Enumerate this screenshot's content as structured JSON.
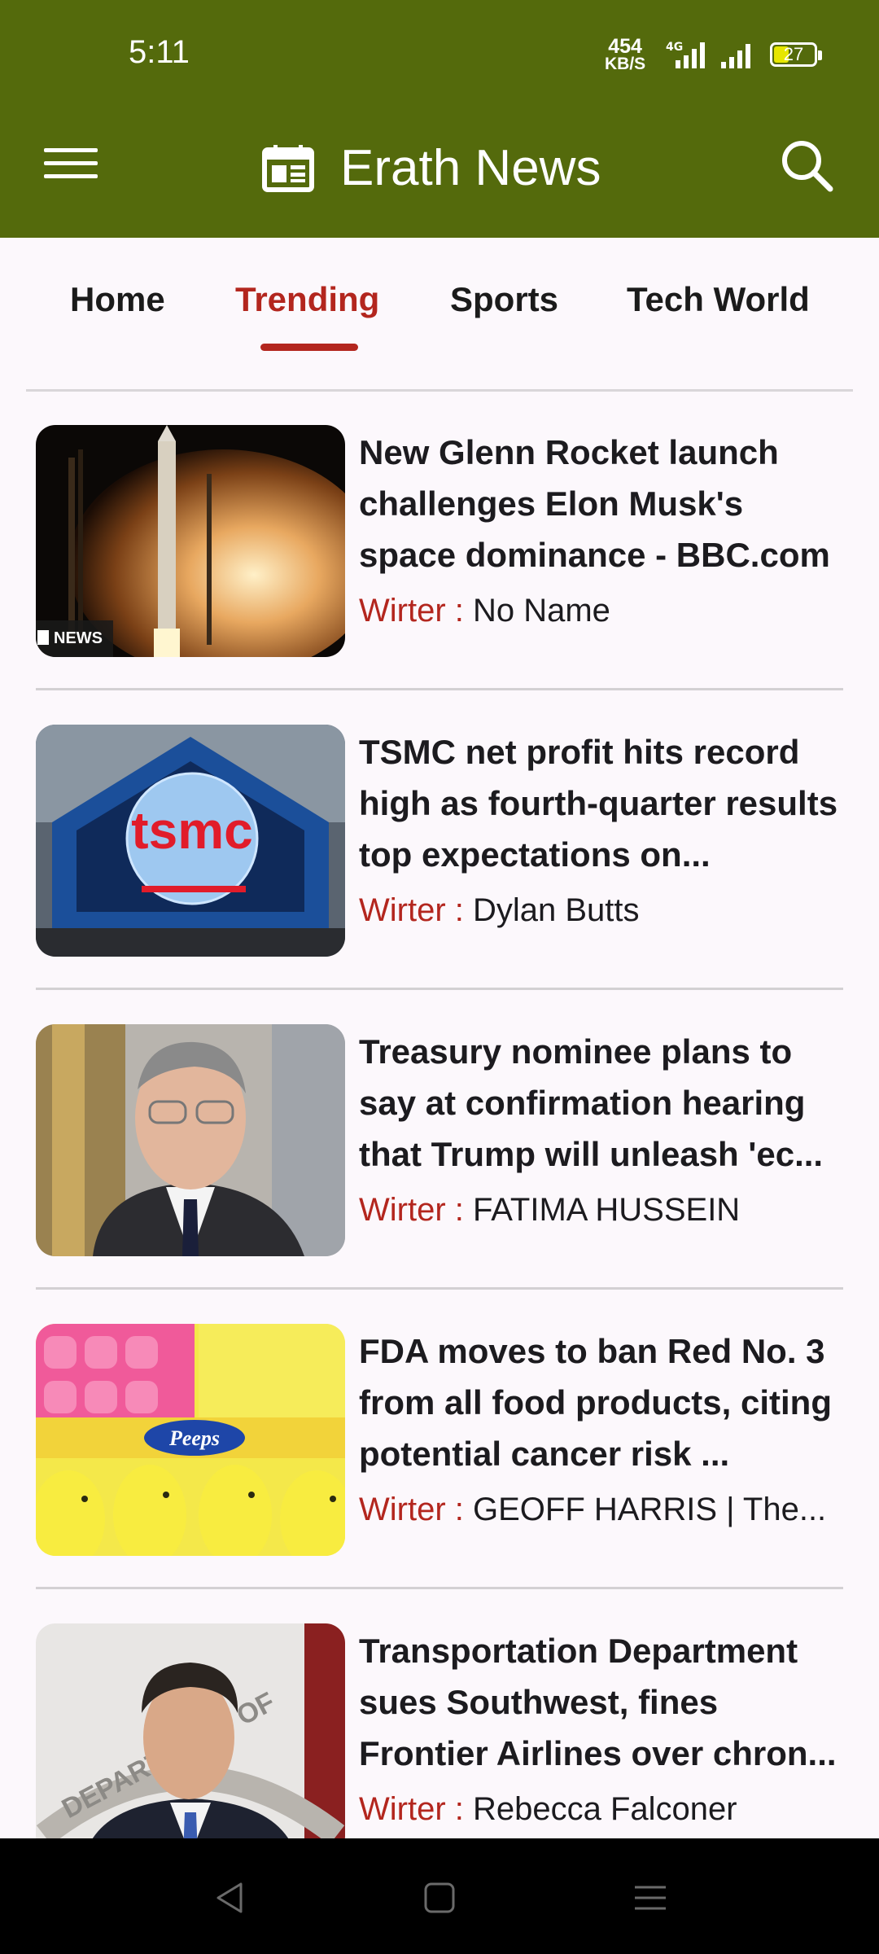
{
  "status_bar": {
    "time": "5:11",
    "net_speed_value": "454",
    "net_speed_unit": "KB/S",
    "network_type": "4G",
    "battery_level": "27"
  },
  "app_bar": {
    "title": "Erath News",
    "menu_icon": "hamburger-menu-icon",
    "logo_icon": "newspaper-icon",
    "search_icon": "search-icon"
  },
  "tabs": [
    {
      "label": "Home",
      "active": false
    },
    {
      "label": "Trending",
      "active": true
    },
    {
      "label": "Sports",
      "active": false
    },
    {
      "label": "Tech World",
      "active": false
    }
  ],
  "articles": [
    {
      "title": "New Glenn Rocket launch challenges Elon Musk's space dominance - BBC.com",
      "writer_label": "Wirter",
      "separator": " : ",
      "writer": "No Name",
      "image_caption": "NEWS"
    },
    {
      "title": "TSMC net profit hits record high as fourth-quarter results top expectations on...",
      "writer_label": "Wirter",
      "separator": " : ",
      "writer": "Dylan Butts",
      "image_caption": "tsmc"
    },
    {
      "title": "Treasury nominee plans to say at confirmation hearing that Trump will unleash 'ec...",
      "writer_label": "Wirter",
      "separator": " : ",
      "writer": "FATIMA HUSSEIN"
    },
    {
      "title": "FDA moves to ban Red No. 3 from all food products, citing potential cancer risk ...",
      "writer_label": "Wirter",
      "separator": " : ",
      "writer": "GEOFF HARRIS | The...",
      "image_caption": "Peeps"
    },
    {
      "title": "Transportation Department sues Southwest, fines Frontier Airlines over chron...",
      "writer_label": "Wirter",
      "separator": " : ",
      "writer": "Rebecca Falconer",
      "image_caption": "DEPARTMENT OF"
    }
  ],
  "nav_bar": {
    "back_icon": "back-triangle-icon",
    "home_icon": "home-square-icon",
    "recents_icon": "recents-menu-icon"
  },
  "colors": {
    "app_bar": "#546a0c",
    "accent": "#b3261e",
    "background": "#fcf8fc"
  }
}
